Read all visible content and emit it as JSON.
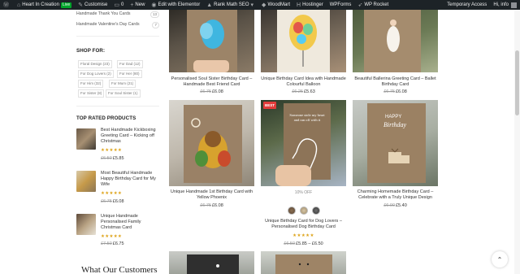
{
  "admin_bar": {
    "site_name": "Heart In Creation",
    "live_badge": "Live",
    "customise": "Customise",
    "comments_count": "0",
    "new_label": "New",
    "elementor": "Edit with Elementor",
    "rankmath": "Rank Math SEO",
    "woodmart": "WoodMart",
    "hostinger": "Hostinger",
    "wpforms": "WPForms",
    "wprocket": "WP Rocket",
    "temporary_access": "Temporary Access",
    "greeting": "Hi, info"
  },
  "sidebar": {
    "categories": [
      {
        "name": "Handmade Thank You Cards",
        "count": "13"
      },
      {
        "name": "Handmade Valentine's Day Cards",
        "count": "7"
      }
    ],
    "shop_for_title": "SHOP FOR:",
    "tags": [
      "Floral Design (23)",
      "For Dad (12)",
      "For Dog Lovers (2)",
      "For Her (80)",
      "For Him (32)",
      "For Mum (21)",
      "For Sister (8)",
      "For Soul Sister (1)"
    ],
    "top_rated_title": "TOP RATED PRODUCTS",
    "top_rated": [
      {
        "title": "Best Handmade Kickboxing Greeting Card – Kicking off Christmas",
        "stars": "★★★★★",
        "old_price": "£6.50",
        "price": "£5.85"
      },
      {
        "title": "Most Beautiful Handmade Happy Birthday Card for My Wife",
        "stars": "★★★★★",
        "old_price": "£6.75",
        "price": "£6.08"
      },
      {
        "title": "Unique Handmade Personalised Family Christmas Card",
        "stars": "★★★★★",
        "old_price": "£7.50",
        "price": "£6.75"
      }
    ],
    "customers_heading": "What Our Customers"
  },
  "products": [
    {
      "title": "Personalised Soul Sister Birthday Card – Handmade Best Friend Card",
      "old_price": "£6.75",
      "price": "£6.08"
    },
    {
      "title": "Unique Birthday Card Idea with Handmade Colourful Balloon",
      "old_price": "£6.25",
      "price": "£5.63"
    },
    {
      "title": "Beautiful Ballerina Greeting Card – Ballet Birthday Card",
      "old_price": "£6.75",
      "price": "£6.08"
    },
    {
      "title": "Unique Handmade 1st Birthday Card with Yellow Phoenix",
      "old_price": "£6.75",
      "price": "£6.08"
    },
    {
      "title": "Unique Birthday Card for Dog Lovers – Personalised Dog Birthday Card",
      "old_price": "£6.50",
      "price": "£5.85 – £6.50",
      "badge": "BEST",
      "discount": "10% OFF",
      "stars": "★★★★★"
    },
    {
      "title": "Charming Homemade Birthday Card – Celebrate with a Truly Unique Design",
      "old_price": "£6.00",
      "price": "£5.40"
    }
  ],
  "card_texts": {
    "dog_card": "Someone stole my heart and ran off with it",
    "happy_birthday": "HAPPY Birthday"
  },
  "colors": {
    "admin_bar": "#1d2327",
    "live": "#00a32a",
    "badge": "#e23b3b",
    "stars": "#dea41c",
    "card_kraft": "#9c8468"
  },
  "icons": {
    "scroll_top": "chevron-up-icon"
  }
}
